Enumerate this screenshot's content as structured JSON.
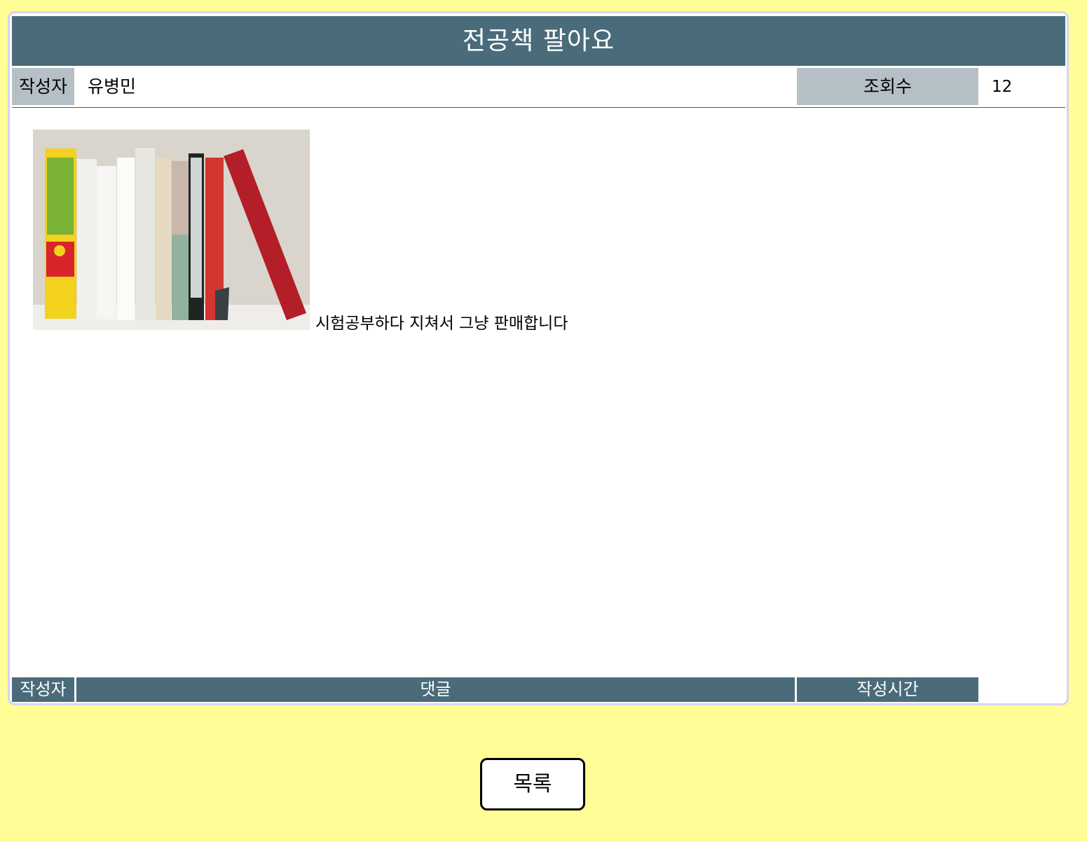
{
  "post": {
    "title": "전공책 팔아요",
    "author_label": "작성자",
    "author": "유병민",
    "views_label": "조회수",
    "views": "12",
    "content_text": "시험공부하다 지쳐서 그냥 판매합니다",
    "image_subject": "books-on-shelf"
  },
  "comments": {
    "header": {
      "author": "작성자",
      "comment": "댓글",
      "time": "작성시간"
    }
  },
  "footer": {
    "list_button": "목록"
  },
  "colors": {
    "background": "#fffd96",
    "header_bar": "#4a6b79",
    "label_cell": "#b5c0c6",
    "panel_border": "#d6d3ee"
  }
}
